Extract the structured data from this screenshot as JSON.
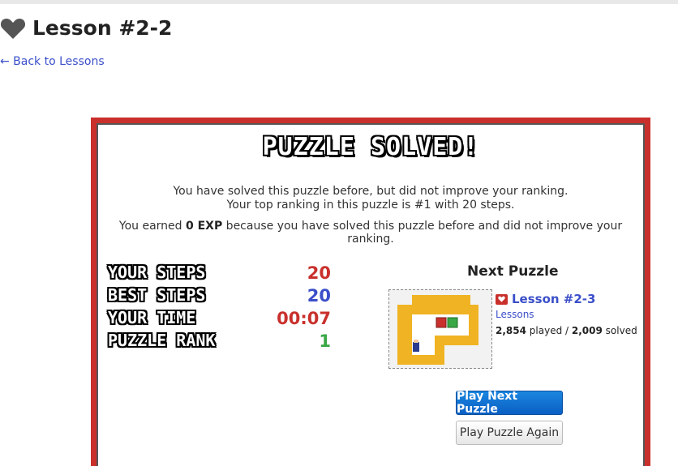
{
  "page": {
    "title": "Lesson #2-2",
    "back_link": "← Back to Lessons"
  },
  "modal": {
    "heading": "PUZZLE SOLVED!",
    "message_line1": "You have solved this puzzle before, but did not improve your ranking.",
    "message_line2": "Your top ranking in this puzzle is #1 with 20 steps.",
    "earned_prefix": "You earned ",
    "earned_exp": "0 EXP",
    "earned_suffix": " because you have solved this puzzle before and did not improve your ranking."
  },
  "stats": [
    {
      "label": "YOUR STEPS",
      "value": "20",
      "color": "#c9302c"
    },
    {
      "label": "BEST STEPS",
      "value": "20",
      "color": "#3b4fc9"
    },
    {
      "label": "YOUR TIME",
      "value": "00:07",
      "color": "#c9302c"
    },
    {
      "label": "PUZZLE RANK",
      "value": "1",
      "color": "#3aa845"
    }
  ],
  "next_puzzle": {
    "heading": "Next Puzzle",
    "lesson_name": "Lesson #2-3",
    "category": "Lessons",
    "played_count": "2,854",
    "played_label": " played / ",
    "solved_count": "2,009",
    "solved_label": " solved",
    "play_next_label": "Play Next Puzzle",
    "play_again_label": "Play Puzzle Again"
  },
  "colors": {
    "accent_red": "#c9302c",
    "link_blue": "#3b4fc9",
    "primary_button": "#0b5fc4"
  },
  "icons": {
    "title": "heart-icon",
    "lesson": "heart-badge-icon"
  }
}
